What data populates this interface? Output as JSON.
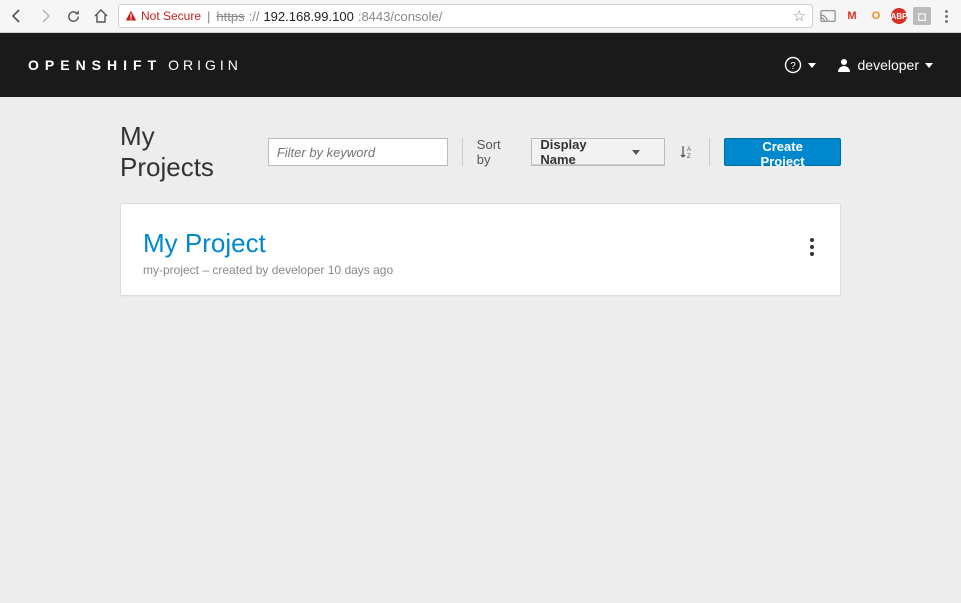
{
  "browser": {
    "not_secure": "Not Secure",
    "url_scheme": "https",
    "url_host": "192.168.99.100",
    "url_port_path": ":8443/console/",
    "ext_gmail": "M",
    "ext_o": "O",
    "ext_abp": "ABP"
  },
  "header": {
    "brand_bold": "OPENSHIFT",
    "brand_light": "ORIGIN",
    "username": "developer"
  },
  "toolbar": {
    "page_title": "My Projects",
    "filter_placeholder": "Filter by keyword",
    "sort_label": "Sort by",
    "sort_value": "Display Name",
    "create_label": "Create Project"
  },
  "project": {
    "display_name": "My Project",
    "meta": "my-project – created by developer 10 days ago"
  }
}
